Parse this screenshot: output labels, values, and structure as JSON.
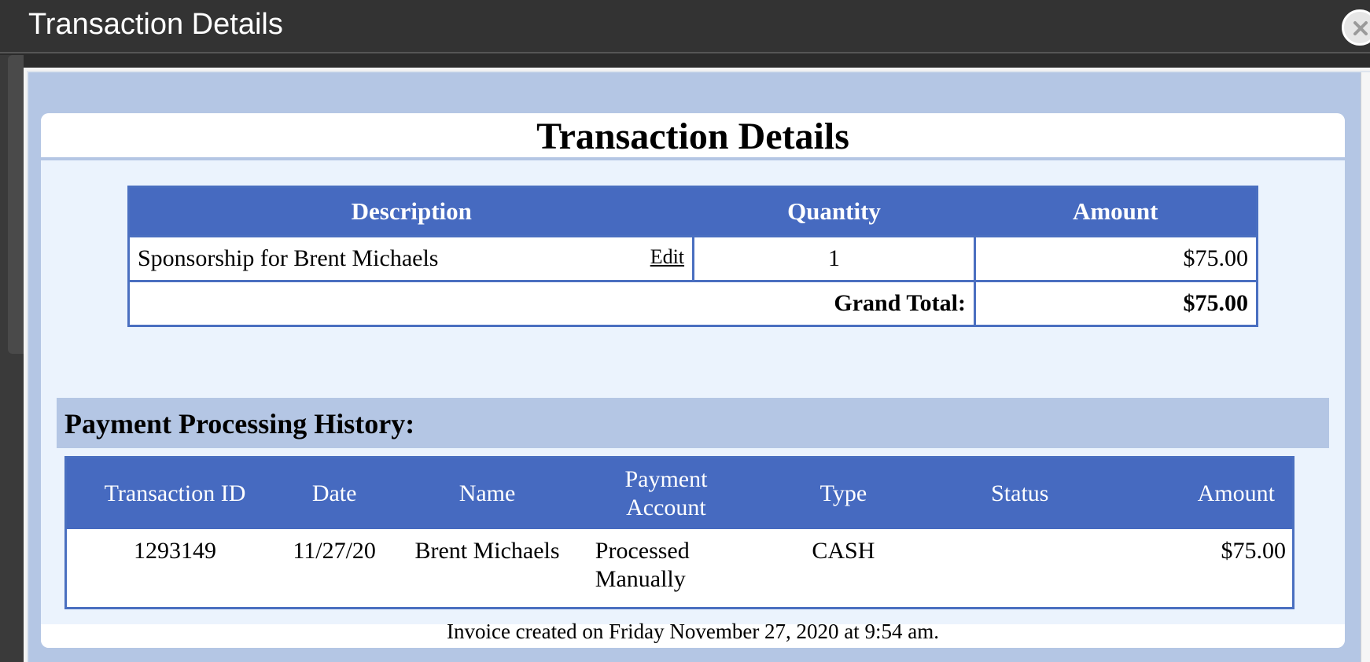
{
  "window": {
    "title": "Transaction Details",
    "close_icon": "close-icon"
  },
  "panel": {
    "title": "Transaction Details"
  },
  "items_table": {
    "headers": [
      "Description",
      "Quantity",
      "Amount"
    ],
    "rows": [
      {
        "description": "Sponsorship for Brent Michaels",
        "edit_label": "Edit",
        "quantity": "1",
        "amount": "$75.00"
      }
    ],
    "grand_total_label": "Grand Total:",
    "grand_total_value": "$75.00"
  },
  "history": {
    "title": "Payment Processing History:",
    "headers": [
      "Transaction ID",
      "Date",
      "Name",
      "Payment Account",
      "Type",
      "Status",
      "Amount"
    ],
    "rows": [
      {
        "transaction_id": "1293149",
        "date": "11/27/20",
        "name": "Brent Michaels",
        "payment_account": "Processed Manually",
        "type": "CASH",
        "status": "",
        "amount": "$75.00"
      }
    ]
  },
  "footer": {
    "invoice_note": "Invoice created on Friday November 27, 2020 at 9:54 am."
  },
  "colors": {
    "titlebar": "#333333",
    "header_blue": "#466ac0",
    "light_blue": "#b4c6e4",
    "panel_bg": "#ebf3fd"
  }
}
